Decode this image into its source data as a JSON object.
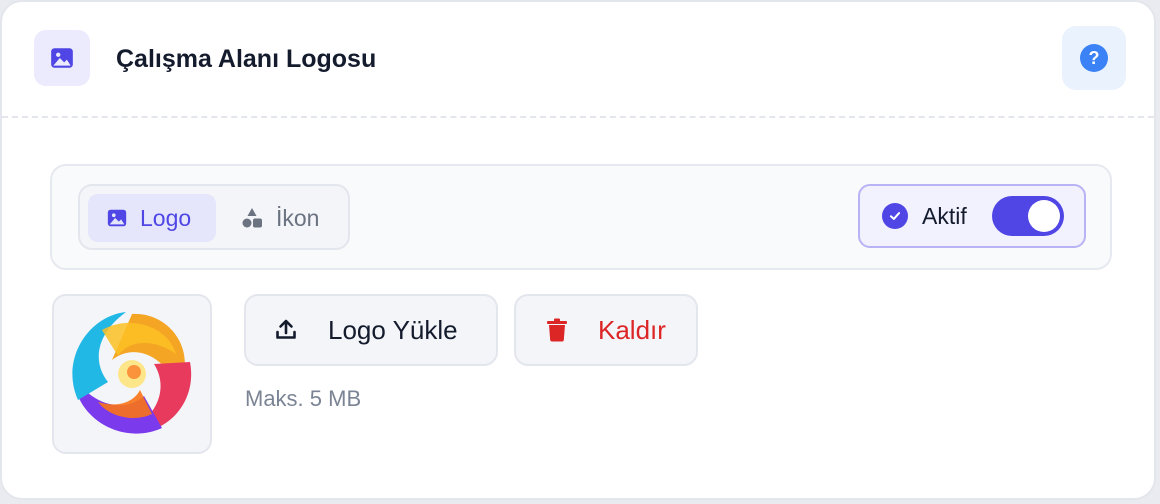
{
  "header": {
    "title": "Çalışma Alanı Logosu",
    "icon": "image-icon",
    "help_icon": "help-icon",
    "help_glyph": "?"
  },
  "tabs": [
    {
      "label": "Logo",
      "icon": "image-icon",
      "active": true
    },
    {
      "label": "İkon",
      "icon": "shapes-icon",
      "active": false
    }
  ],
  "status_toggle": {
    "label": "Aktif",
    "on": true
  },
  "actions": {
    "upload_label": "Logo Yükle",
    "remove_label": "Kaldır"
  },
  "hint": "Maks. 5 MB",
  "colors": {
    "accent": "#4f46e5",
    "danger": "#dc2626",
    "help": "#3b82f6"
  }
}
